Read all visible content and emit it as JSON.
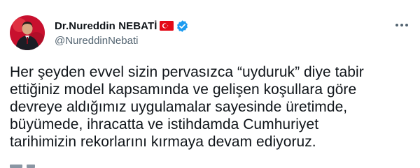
{
  "author": {
    "display_name": "Dr.Nureddin NEBATİ",
    "handle": "@NureddinNebati",
    "flag_icon": "turkey-flag-icon",
    "verified_icon": "verified-badge-icon",
    "verified_color": "#1d9bf0"
  },
  "menu": {
    "icon": "more-options-icon"
  },
  "tweet": {
    "lines": [
      "Her şeyden evvel sizin pervasızca “uyduruk” diye tabir",
      "ettiğiniz model kapsamında ve gelişen koşullara göre",
      "devreye aldığımız uygulamalar sayesinde üretimde,",
      "büyümede, ihracatta ve istihdamda Cumhuriyet",
      "tarihimizin rekorlarını kırmaya devam ediyoruz."
    ]
  },
  "colors": {
    "text": "#0f1419",
    "secondary": "#536471",
    "flag_red": "#e30a17"
  }
}
